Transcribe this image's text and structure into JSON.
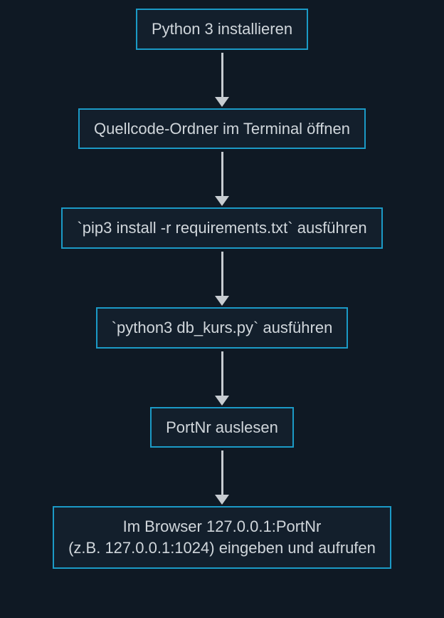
{
  "flow": {
    "nodes": [
      {
        "id": "step-install-python",
        "label": "Python 3 installieren"
      },
      {
        "id": "step-open-folder",
        "label": "Quellcode-Ordner im Terminal öffnen"
      },
      {
        "id": "step-pip-install",
        "label": "`pip3 install -r requirements.txt` ausführen"
      },
      {
        "id": "step-run-script",
        "label": "`python3 db_kurs.py` ausführen"
      },
      {
        "id": "step-read-port",
        "label": "PortNr auslesen"
      },
      {
        "id": "step-open-browser",
        "label": "Im Browser 127.0.0.1:PortNr\n(z.B. 127.0.0.1:1024) eingeben und aufrufen"
      }
    ]
  }
}
